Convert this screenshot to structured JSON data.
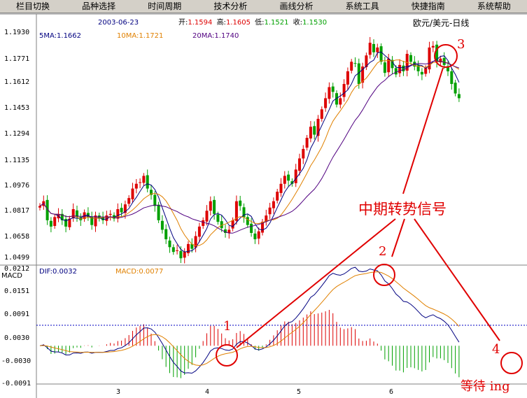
{
  "menu": [
    "栏目切换",
    "品种选择",
    "时间周期",
    "技术分析",
    "画线分析",
    "系统工具",
    "快捷指南",
    "系统帮助"
  ],
  "chart_data": [
    {
      "type": "candlestick",
      "title": "欧元/美元-日线",
      "date": "2003-06-23",
      "ohlc_labels": {
        "open_label": "开:",
        "open": "1.1594",
        "high_label": "高:",
        "high": "1.1605",
        "low_label": "低:",
        "low": "1.1521",
        "close_label": "收:",
        "close": "1.1530"
      },
      "ma_labels": [
        {
          "name": "5MA",
          "value": "1.1662",
          "color": "#000080"
        },
        {
          "name": "10MA",
          "value": "1.1721",
          "color": "#e08000"
        },
        {
          "name": "20MA",
          "value": "1.1740",
          "color": "#500080"
        }
      ],
      "ylim": [
        1.0499,
        1.196
      ],
      "yticks": [
        "1.1930",
        "1.1771",
        "1.1612",
        "1.1453",
        "1.1294",
        "1.1135",
        "1.0976",
        "1.0817",
        "1.0658",
        "1.0499"
      ],
      "xticks": [
        "3",
        "4",
        "5",
        "6"
      ],
      "colors": {
        "up": "#dd0000",
        "down": "#00a000"
      },
      "closes": [
        1.085,
        1.088,
        1.076,
        1.072,
        1.078,
        1.08,
        1.076,
        1.072,
        1.077,
        1.083,
        1.078,
        1.076,
        1.081,
        1.078,
        1.073,
        1.079,
        1.077,
        1.076,
        1.079,
        1.08,
        1.077,
        1.083,
        1.081,
        1.086,
        1.09,
        1.096,
        1.099,
        1.1,
        1.104,
        1.096,
        1.092,
        1.085,
        1.076,
        1.07,
        1.064,
        1.059,
        1.056,
        1.057,
        1.052,
        1.056,
        1.061,
        1.058,
        1.066,
        1.072,
        1.076,
        1.082,
        1.088,
        1.08,
        1.075,
        1.071,
        1.068,
        1.07,
        1.076,
        1.088,
        1.085,
        1.078,
        1.073,
        1.068,
        1.064,
        1.069,
        1.075,
        1.079,
        1.084,
        1.088,
        1.094,
        1.099,
        1.104,
        1.101,
        1.099,
        1.108,
        1.115,
        1.121,
        1.128,
        1.135,
        1.13,
        1.14,
        1.146,
        1.153,
        1.16,
        1.157,
        1.149,
        1.153,
        1.162,
        1.17,
        1.176,
        1.175,
        1.162,
        1.173,
        1.18,
        1.188,
        1.182,
        1.185,
        1.176,
        1.169,
        1.178,
        1.172,
        1.168,
        1.174,
        1.17,
        1.181,
        1.176,
        1.173,
        1.17,
        1.168,
        1.172,
        1.185,
        1.186,
        1.176,
        1.178,
        1.174,
        1.17,
        1.162,
        1.156,
        1.153
      ]
    },
    {
      "type": "macd",
      "label": "MACD",
      "dif_label": "DIF:0.0032",
      "macd_label": "MACD:0.0077",
      "ylim": [
        -0.01,
        0.0215
      ],
      "yticks": [
        "0.0212",
        "0.0151",
        "0.0091",
        "0.0030",
        "-0.0030",
        "-0.0091"
      ],
      "colors": {
        "dif": "#000080",
        "macd": "#e08000",
        "pos": "#dd0000",
        "neg": "#00a000"
      }
    }
  ],
  "annotations": {
    "title": "中期转势信号",
    "marks": [
      "1",
      "2",
      "3",
      "4"
    ],
    "waiting": "等待 ing"
  }
}
